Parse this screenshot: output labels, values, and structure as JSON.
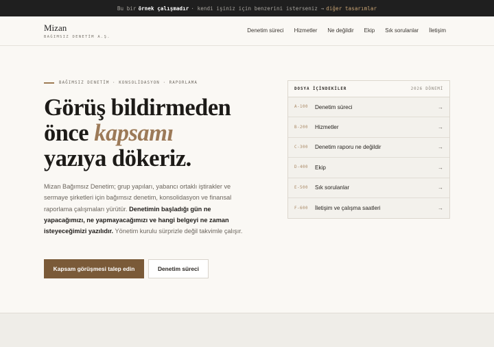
{
  "topbar": {
    "prefix": "Bu bir",
    "emphasis": "örnek çalışmadır",
    "middle": "· kendi işiniz için benzerini isterseniz →",
    "link": "diğer tasarımlar"
  },
  "brand": {
    "name": "Mizan",
    "subtitle": "BAĞIMSIZ DENETİM A.Ş."
  },
  "nav": [
    "Denetim süreci",
    "Hizmetler",
    "Ne değildir",
    "Ekip",
    "Sık sorulanlar",
    "İletişim"
  ],
  "hero": {
    "eyebrow": "BAĞIMSIZ DENETİM · KONSOLİDASYON · RAPORLAMA",
    "headline_line1": "Görüş bildirmeden",
    "headline_line2_plain": "önce",
    "headline_line2_italic": "kapsamı",
    "headline_line3": "yazıya dökeriz.",
    "lead_part1": "Mizan Bağımsız Denetim; grup yapıları, yabancı ortaklı iştirakler ve sermaye şirketleri için bağımsız denetim, konsolidasyon ve finansal raporlama çalışmaları yürütür.",
    "lead_bold": "Denetimin başladığı gün ne yapacağımızı, ne yapmayacağımızı ve hangi belgeyi ne zaman isteyeceğimizi yazılıdır.",
    "lead_part2": "Yönetim kurulu sürprizle değil takvimle çalışır.",
    "primary_button": "Kapsam görüşmesi talep edin",
    "secondary_button": "Denetim süreci"
  },
  "toc": {
    "title": "DOSYA İÇİNDEKİLER",
    "period": "2026 DÖNEMİ",
    "items": [
      {
        "code": "A-100",
        "label": "Denetim süreci"
      },
      {
        "code": "B-200",
        "label": "Hizmetler"
      },
      {
        "code": "C-300",
        "label": "Denetim raporu ne değildir"
      },
      {
        "code": "D-400",
        "label": "Ekip"
      },
      {
        "code": "E-500",
        "label": "Sık sorulanlar"
      },
      {
        "code": "F-600",
        "label": "İletişim ve çalışma saatleri"
      }
    ],
    "arrow": "→"
  },
  "colors": {
    "accent": "#7a5a38",
    "accent_light": "#9c7a58",
    "topbar_bg": "#1f1f1f",
    "page_bg": "#faf8f4"
  }
}
